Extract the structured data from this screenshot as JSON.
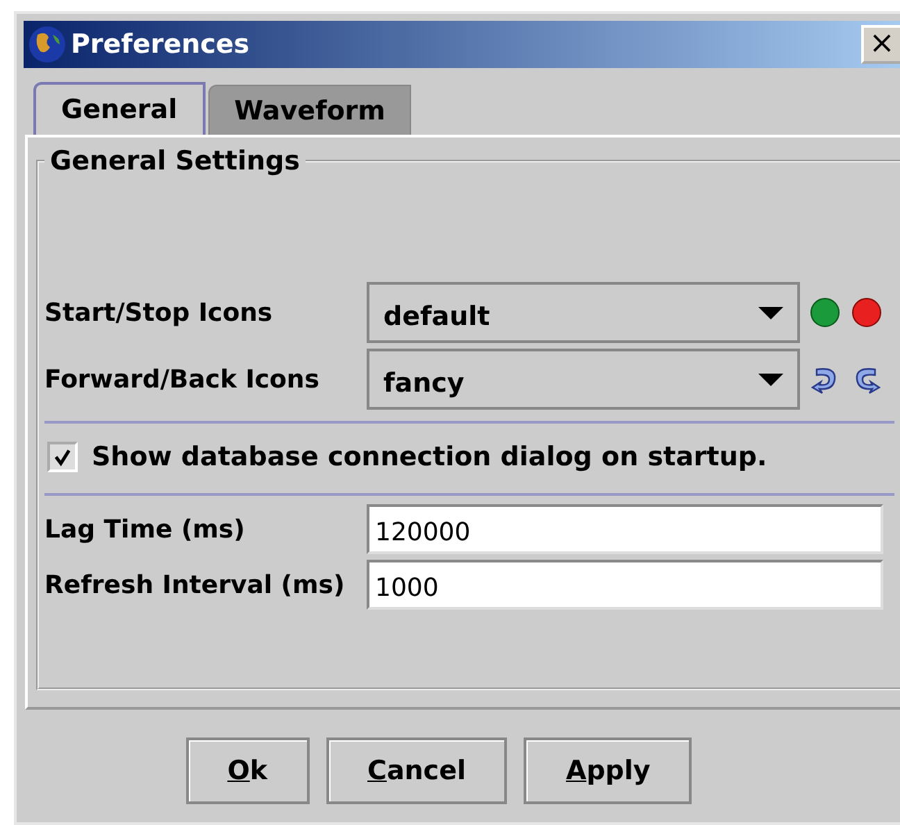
{
  "window": {
    "title": "Preferences",
    "close": "×"
  },
  "tabs": [
    {
      "label": "General",
      "selected": true
    },
    {
      "label": "Waveform",
      "selected": false
    }
  ],
  "group": {
    "title": "General Settings"
  },
  "dropdowns": [
    {
      "label": "Start/Stop Icons",
      "value": "default",
      "kind": "dots"
    },
    {
      "label": "Forward/Back Icons",
      "value": "fancy",
      "kind": "arrows"
    }
  ],
  "checkbox": {
    "label": "Show database connection dialog on startup.",
    "checked": true
  },
  "fields": [
    {
      "label": "Lag Time (ms)",
      "value": "120000"
    },
    {
      "label": "Refresh Interval (ms)",
      "value": "1000"
    }
  ],
  "buttons": [
    "Ok",
    "Cancel",
    "Apply"
  ]
}
